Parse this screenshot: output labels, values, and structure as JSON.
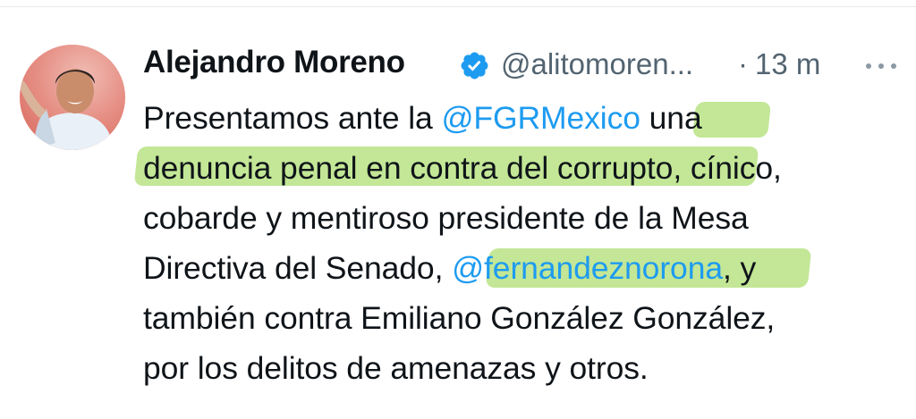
{
  "tweet": {
    "author_name": "Alejandro Moreno",
    "handle": "@alitomoren...",
    "separator": "·",
    "time": "13 m",
    "body_lines": [
      {
        "text_before": "Presentamos ante la ",
        "mention": "@FGRMexico",
        "text_after": " una"
      },
      {
        "text": "denuncia penal en contra del corrupto, cínico,"
      },
      {
        "text": "cobarde y mentiroso presidente de la Mesa"
      },
      {
        "text_before": "Directiva del Senado, ",
        "mention": "@fernandeznorona",
        "text_after": ", y"
      },
      {
        "text": "también contra Emiliano González González,"
      },
      {
        "text": "por los delitos de amenazas y otros."
      }
    ]
  },
  "icons": {
    "verified": "verified-badge-icon",
    "more": "more-options-icon"
  },
  "colors": {
    "mention": "#1d9bf0",
    "verified": "#1d9bf0",
    "muted": "#536471",
    "highlight": "#92d340"
  }
}
